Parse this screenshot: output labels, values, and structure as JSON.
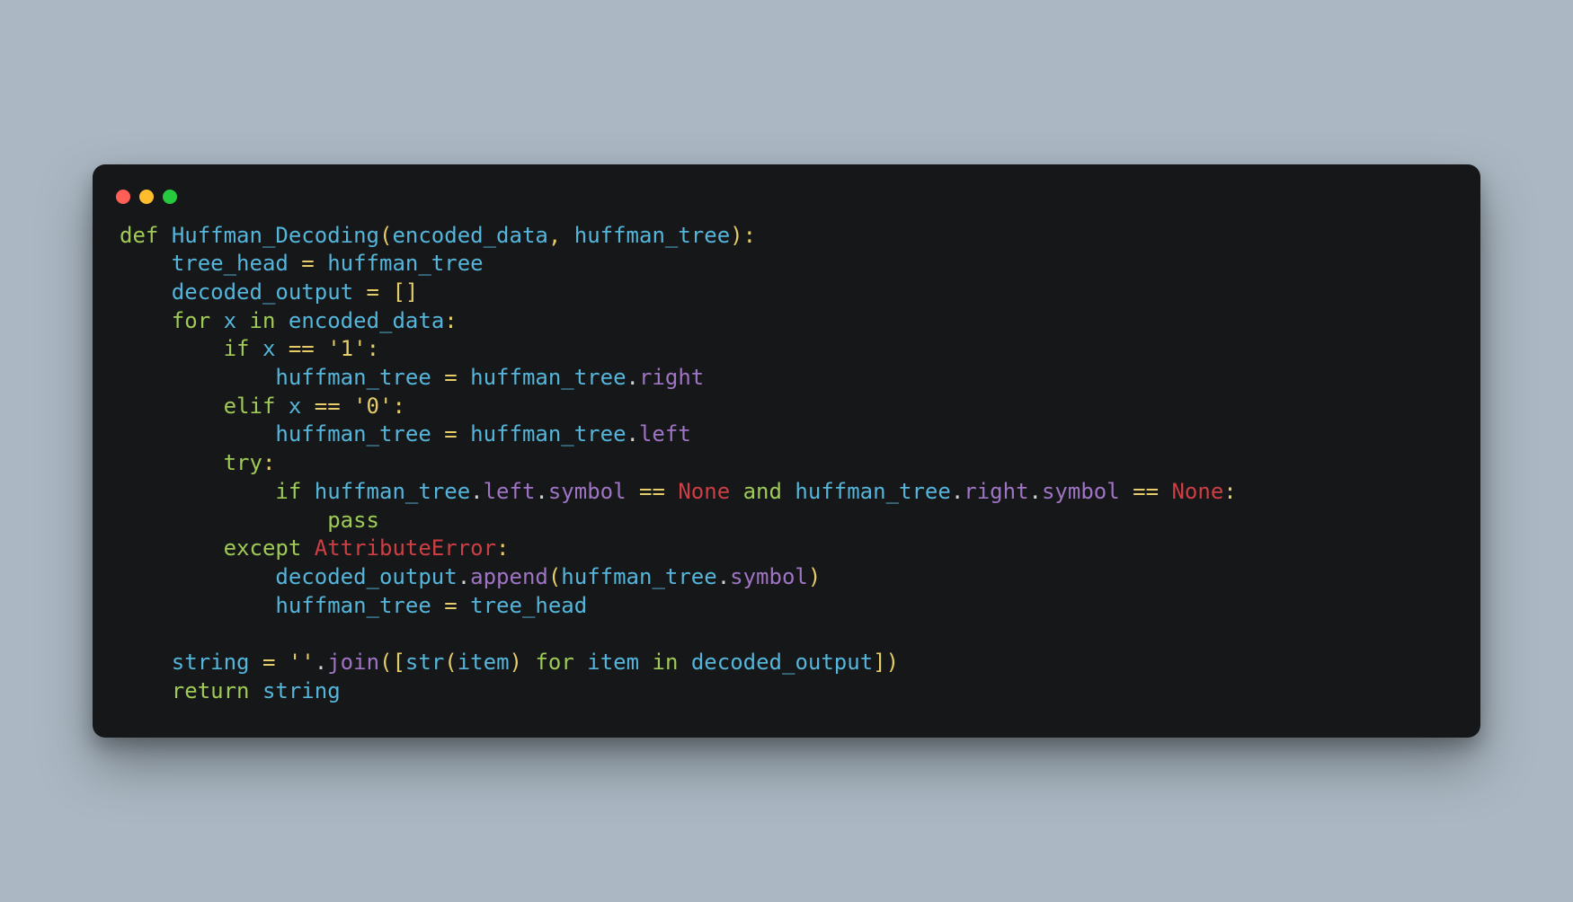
{
  "traffic_lights": [
    "red",
    "yellow",
    "green"
  ],
  "code": {
    "line1": {
      "def": "def",
      "sp": " ",
      "fname": "Huffman_Decoding",
      "lp": "(",
      "arg1": "encoded_data",
      "comma": ",",
      "sp2": " ",
      "arg2": "huffman_tree",
      "rp": ")",
      "colon": ":"
    },
    "line2": {
      "indent": "    ",
      "id1": "tree_head",
      "sp1": " ",
      "eq": "=",
      "sp2": " ",
      "id2": "huffman_tree"
    },
    "line3": {
      "indent": "    ",
      "id1": "decoded_output",
      "sp1": " ",
      "eq": "=",
      "sp2": " ",
      "lb": "[",
      "rb": "]"
    },
    "line4": {
      "indent": "    ",
      "for": "for",
      "sp1": " ",
      "x": "x",
      "sp2": " ",
      "in": "in",
      "sp3": " ",
      "id": "encoded_data",
      "colon": ":"
    },
    "line5": {
      "indent": "        ",
      "if": "if",
      "sp1": " ",
      "x": "x",
      "sp2": " ",
      "eq": "==",
      "sp3": " ",
      "str": "'1'",
      "colon": ":"
    },
    "line6": {
      "indent": "            ",
      "id1": "huffman_tree",
      "sp1": " ",
      "eq": "=",
      "sp2": " ",
      "id2": "huffman_tree",
      "dot": ".",
      "attr": "right"
    },
    "line7": {
      "indent": "        ",
      "elif": "elif",
      "sp1": " ",
      "x": "x",
      "sp2": " ",
      "eq": "==",
      "sp3": " ",
      "str": "'0'",
      "colon": ":"
    },
    "line8": {
      "indent": "            ",
      "id1": "huffman_tree",
      "sp1": " ",
      "eq": "=",
      "sp2": " ",
      "id2": "huffman_tree",
      "dot": ".",
      "attr": "left"
    },
    "line9": {
      "indent": "        ",
      "try": "try",
      "colon": ":"
    },
    "line10": {
      "indent": "            ",
      "if": "if",
      "sp1": " ",
      "id1": "huffman_tree",
      "d1": ".",
      "a1": "left",
      "d2": ".",
      "a2": "symbol",
      "sp2": " ",
      "eq1": "==",
      "sp3": " ",
      "none1": "None",
      "sp4": " ",
      "and": "and",
      "sp5": " ",
      "id2": "huffman_tree",
      "d3": ".",
      "a3": "right",
      "d4": ".",
      "a4": "symbol",
      "sp6": " ",
      "eq2": "==",
      "sp7": " ",
      "none2": "None",
      "colon": ":"
    },
    "line11": {
      "indent": "                ",
      "pass": "pass"
    },
    "line12": {
      "indent": "        ",
      "except": "except",
      "sp1": " ",
      "err": "AttributeError",
      "colon": ":"
    },
    "line13": {
      "indent": "            ",
      "id1": "decoded_output",
      "d1": ".",
      "a1": "append",
      "lp": "(",
      "id2": "huffman_tree",
      "d2": ".",
      "a2": "symbol",
      "rp": ")"
    },
    "line14": {
      "indent": "            ",
      "id1": "huffman_tree",
      "sp1": " ",
      "eq": "=",
      "sp2": " ",
      "id2": "tree_head"
    },
    "line15": {
      "blank": ""
    },
    "line16": {
      "indent": "    ",
      "id1": "string",
      "sp1": " ",
      "eq": "=",
      "sp2": " ",
      "str": "''",
      "d1": ".",
      "a1": "join",
      "lp": "(",
      "lb": "[",
      "strfn": "str",
      "lp2": "(",
      "item1": "item",
      "rp2": ")",
      "sp3": " ",
      "for": "for",
      "sp4": " ",
      "item2": "item",
      "sp5": " ",
      "in": "in",
      "sp6": " ",
      "id2": "decoded_output",
      "rb": "]",
      "rp": ")"
    },
    "line17": {
      "indent": "    ",
      "return": "return",
      "sp1": " ",
      "id": "string"
    }
  }
}
